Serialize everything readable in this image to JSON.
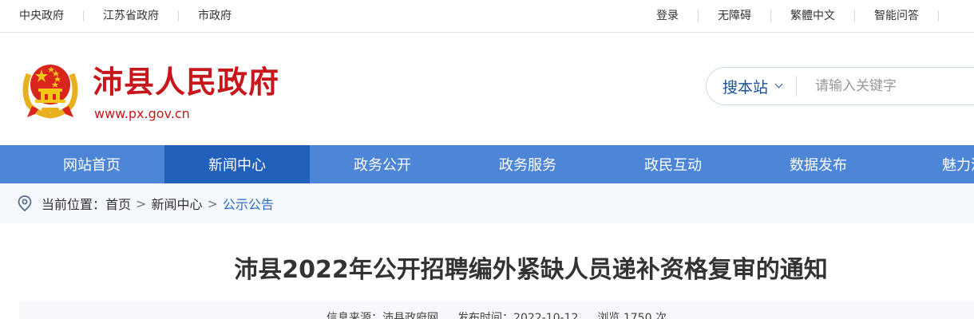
{
  "topbar": {
    "left_links": [
      "中央政府",
      "江苏省政府",
      "市政府"
    ],
    "right_links": [
      "登录",
      "无障碍",
      "繁體中文",
      "智能问答"
    ]
  },
  "header": {
    "site_title": "沛县人民政府",
    "site_url": "www.px.gov.cn",
    "emblem_icon": "national-emblem-icon"
  },
  "search": {
    "scope_label": "搜本站",
    "placeholder": "请输入关键字"
  },
  "nav": {
    "items": [
      "网站首页",
      "新闻中心",
      "政务公开",
      "政务服务",
      "政民互动",
      "数据发布",
      "魅力沛"
    ],
    "active_index": 1
  },
  "breadcrumb": {
    "label": "当前位置：",
    "items": [
      "首页",
      "新闻中心",
      "公示公告"
    ],
    "separator": ">"
  },
  "article": {
    "title": "沛县2022年公开招聘编外紧缺人员递补资格复审的通知",
    "source": "信息来源：沛县政府网",
    "date": "发布时间：2022-10-12",
    "views": "浏览 1750 次"
  },
  "colors": {
    "brand_red": "#c8161d",
    "nav_blue": "#4d86d6",
    "nav_active": "#2160bb",
    "crumb_current": "#2b6cc4"
  }
}
